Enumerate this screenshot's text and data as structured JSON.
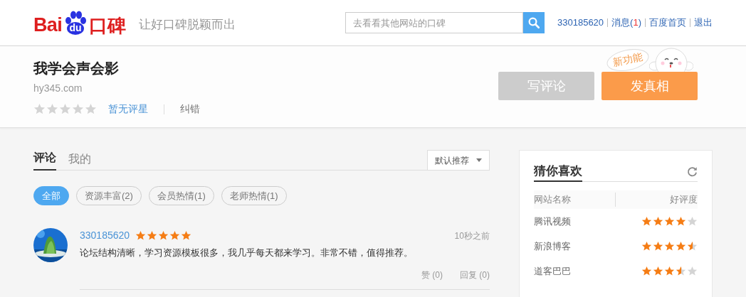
{
  "header": {
    "logo": {
      "text_left": "Bai",
      "paw_text": "du",
      "text_right": "口碑"
    },
    "slogan": "让好口碑脱颖而出",
    "search": {
      "placeholder": "去看看其他网站的口碑"
    },
    "user_links": [
      {
        "text": "330185620"
      },
      {
        "text": "消息(",
        "badge": "1",
        "suffix": ")"
      },
      {
        "text": "百度首页"
      },
      {
        "text": "退出"
      }
    ]
  },
  "site": {
    "name": "我学会声会影",
    "domain": "hy345.com",
    "stars": 0,
    "rating_text": "暂无评星",
    "report": "纠错",
    "bubble": "新功能",
    "buttons": [
      {
        "label": "写评论",
        "kind": "secondary"
      },
      {
        "label": "发真相",
        "kind": "primary"
      }
    ]
  },
  "tabs": [
    {
      "label": "评论",
      "selected": true
    },
    {
      "label": "我的",
      "selected": false
    }
  ],
  "sort": {
    "value": "默认推荐"
  },
  "filters": [
    {
      "label": "全部",
      "selected": true
    },
    {
      "label": "资源丰富(2)",
      "selected": false
    },
    {
      "label": "会员热情(1)",
      "selected": false
    },
    {
      "label": "老师热情(1)",
      "selected": false
    }
  ],
  "reviews": [
    {
      "user": "330185620",
      "stars": 5,
      "time": "10秒之前",
      "text": "论坛结构清晰，学习资源模板很多，我几乎每天都来学习。非常不错，值得推荐。",
      "like": "赞 (0)",
      "reply": "回复 (0)"
    }
  ],
  "sidebar": {
    "title": "猜你喜欢",
    "columns": [
      "网站名称",
      "好评度"
    ],
    "rows": [
      {
        "name": "腾讯视频",
        "stars": 4
      },
      {
        "name": "新浪博客",
        "stars": 4.5
      },
      {
        "name": "道客巴巴",
        "stars": 3.5
      }
    ]
  }
}
